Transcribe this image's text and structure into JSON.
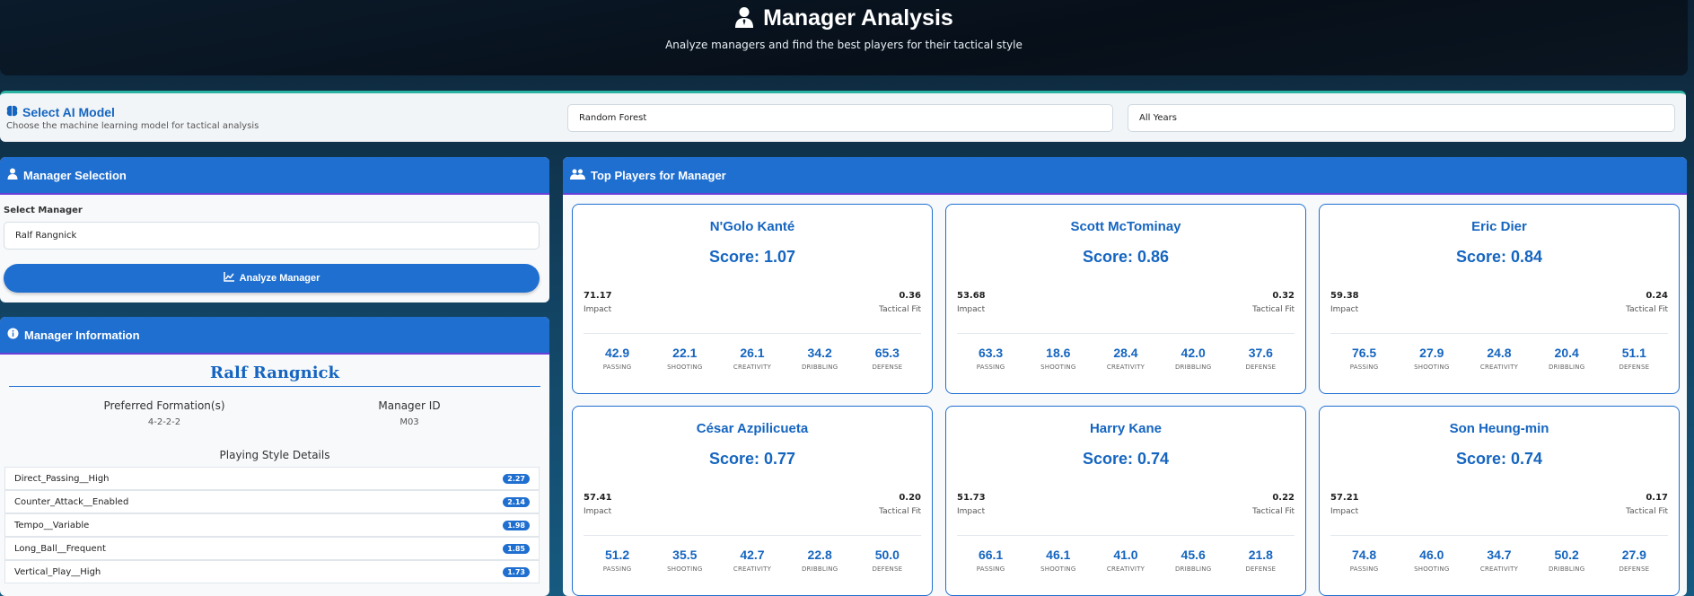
{
  "header": {
    "title": "Manager Analysis",
    "subtitle": "Analyze managers and find the best players for their tactical style"
  },
  "model_bar": {
    "title": "Select AI Model",
    "description": "Choose the machine learning model for tactical analysis",
    "model_value": "Random Forest",
    "year_value": "All Years"
  },
  "manager_selection": {
    "title": "Manager Selection",
    "field_label": "Select Manager",
    "selected": "Ralf Rangnick",
    "button_label": "Analyze Manager"
  },
  "manager_info": {
    "title": "Manager Information",
    "name": "Ralf Rangnick",
    "formation_label": "Preferred Formation(s)",
    "formation_value": "4-2-2-2",
    "id_label": "Manager ID",
    "id_value": "M03",
    "style_heading": "Playing Style Details",
    "styles": [
      {
        "name": "Direct_Passing__High",
        "value": "2.27"
      },
      {
        "name": "Counter_Attack__Enabled",
        "value": "2.14"
      },
      {
        "name": "Tempo__Variable",
        "value": "1.98"
      },
      {
        "name": "Long_Ball__Frequent",
        "value": "1.85"
      },
      {
        "name": "Vertical_Play__High",
        "value": "1.73"
      }
    ]
  },
  "top_players": {
    "title": "Top Players for Manager",
    "impact_label": "Impact",
    "fit_label": "Tactical Fit",
    "stat_labels": [
      "PASSING",
      "SHOOTING",
      "CREATIVITY",
      "DRIBBLING",
      "DEFENSE"
    ],
    "players": [
      {
        "name": "N'Golo Kanté",
        "score": "Score: 1.07",
        "impact": "71.17",
        "fit": "0.36",
        "stats": [
          "42.9",
          "22.1",
          "26.1",
          "34.2",
          "65.3"
        ]
      },
      {
        "name": "Scott McTominay",
        "score": "Score: 0.86",
        "impact": "53.68",
        "fit": "0.32",
        "stats": [
          "63.3",
          "18.6",
          "28.4",
          "42.0",
          "37.6"
        ]
      },
      {
        "name": "Eric Dier",
        "score": "Score: 0.84",
        "impact": "59.38",
        "fit": "0.24",
        "stats": [
          "76.5",
          "27.9",
          "24.8",
          "20.4",
          "51.1"
        ]
      },
      {
        "name": "César Azpilicueta",
        "score": "Score: 0.77",
        "impact": "57.41",
        "fit": "0.20",
        "stats": [
          "51.2",
          "35.5",
          "42.7",
          "22.8",
          "50.0"
        ]
      },
      {
        "name": "Harry Kane",
        "score": "Score: 0.74",
        "impact": "51.73",
        "fit": "0.22",
        "stats": [
          "66.1",
          "46.1",
          "41.0",
          "45.6",
          "21.8"
        ]
      },
      {
        "name": "Son Heung-min",
        "score": "Score: 0.74",
        "impact": "57.21",
        "fit": "0.17",
        "stats": [
          "74.8",
          "46.0",
          "34.7",
          "50.2",
          "27.9"
        ]
      }
    ]
  },
  "colors": {
    "accent": "#1f6fd0",
    "header_bg": "#070f19",
    "teal_line": "#2ab3a3"
  }
}
